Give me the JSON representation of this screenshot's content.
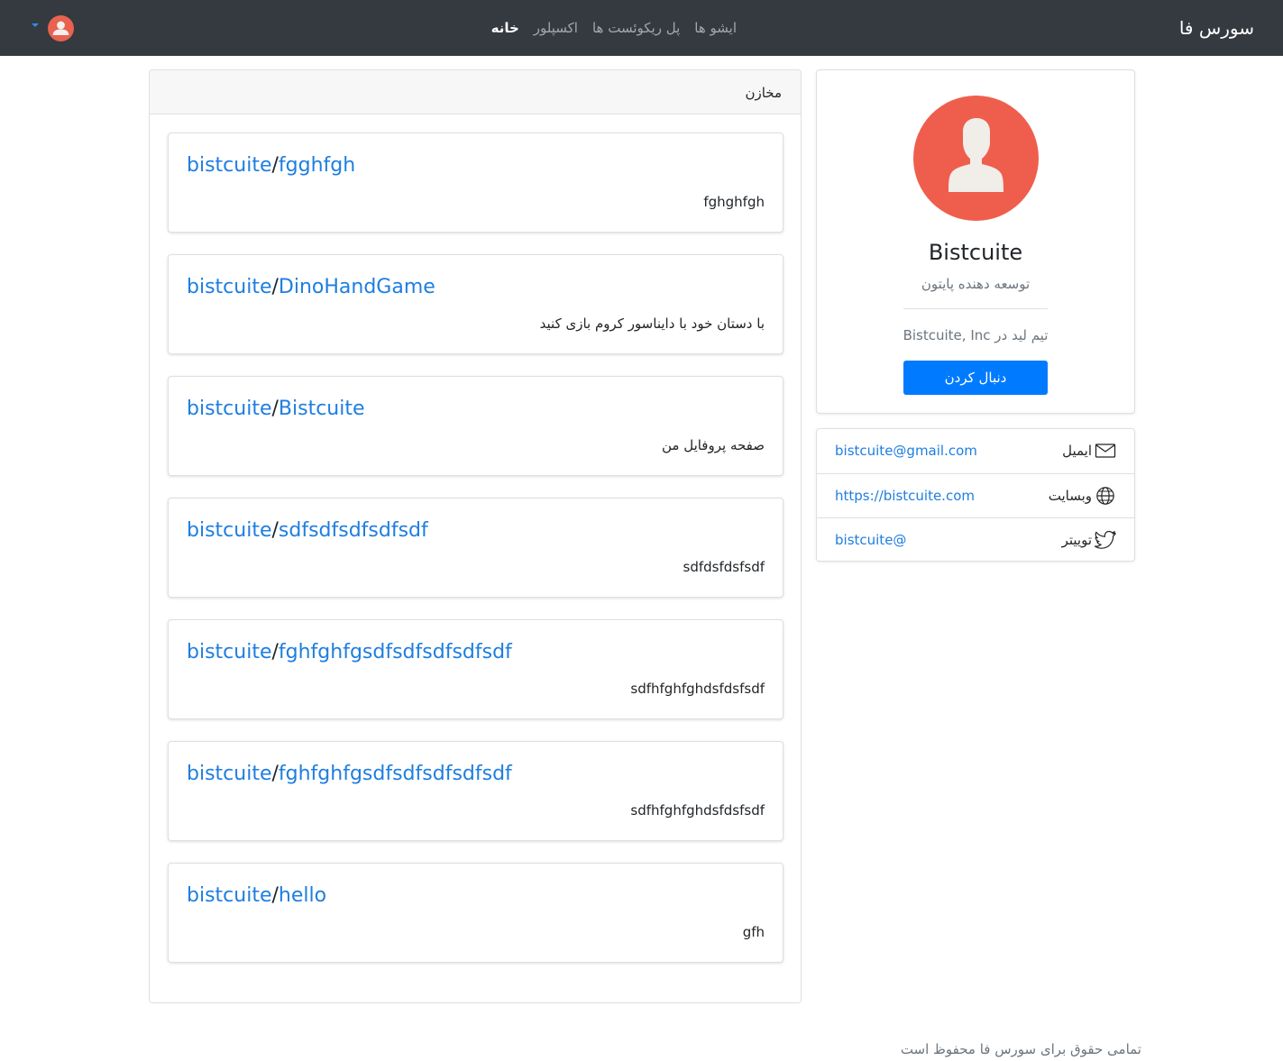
{
  "navbar": {
    "brand": "سورس فا",
    "links": [
      {
        "label": "خانه",
        "active": true
      },
      {
        "label": "اکسپلور",
        "active": false
      },
      {
        "label": "پل ریکوئست ها",
        "active": false
      },
      {
        "label": "ایشو ها",
        "active": false
      }
    ],
    "avatar_icon": "user-avatar-icon",
    "caret_icon": "caret-down-icon"
  },
  "repositories": {
    "title": "مخازن",
    "items": [
      {
        "owner": "bistcuite",
        "separator": "/",
        "name": "fgghfgh",
        "description": "fghghfgh"
      },
      {
        "owner": "bistcuite",
        "separator": "/",
        "name": "DinoHandGame",
        "description": "با دستان خود با دایناسور کروم بازی کنید"
      },
      {
        "owner": "bistcuite",
        "separator": "/",
        "name": "Bistcuite",
        "description": "صفحه پروفایل من"
      },
      {
        "owner": "bistcuite",
        "separator": "/",
        "name": "sdfsdfsdfsdfsdf",
        "description": "sdfdsfdsfsdf"
      },
      {
        "owner": "bistcuite",
        "separator": "/",
        "name": "fghfghfgsdfsdfsdfsdfsdf",
        "description": "sdfhfghfghdsfdsfsdf"
      },
      {
        "owner": "bistcuite",
        "separator": "/",
        "name": "fghfghfgsdfsdfsdfsdfsdf",
        "description": "sdfhfghfghdsfdsfsdf"
      },
      {
        "owner": "bistcuite",
        "separator": "/",
        "name": "hello",
        "description": "gfh"
      }
    ]
  },
  "profile": {
    "name": "Bistcuite",
    "bio": "توسعه دهنده پایتون",
    "company": "تیم لید در Bistcuite, Inc",
    "follow_label": "دنبال کردن",
    "avatar_icon": "user-avatar-icon"
  },
  "contacts": [
    {
      "label": "ایمیل",
      "icon": "envelope-icon",
      "value": "bistcuite@gmail.com"
    },
    {
      "label": "وبسایت",
      "icon": "globe-icon",
      "value": "https://bistcuite.com"
    },
    {
      "label": "توییتر",
      "icon": "twitter-icon",
      "value": "bistcuite@"
    }
  ],
  "footer": {
    "text": "تمامی حقوق برای سورس فا محفوظ است"
  },
  "colors": {
    "navbar_bg": "#343a40",
    "link_blue": "#1e7ee0",
    "button_blue": "#007bff",
    "avatar_red": "#ef5e4c"
  }
}
